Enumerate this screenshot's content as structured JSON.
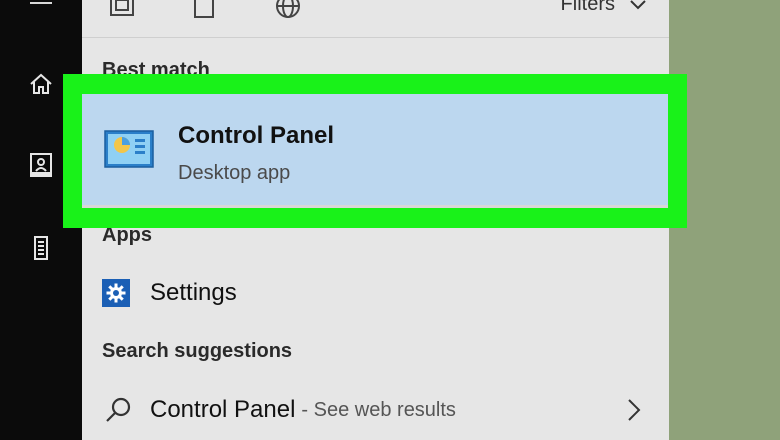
{
  "sidebar": {
    "icons": [
      "hamburger-icon",
      "home-icon",
      "notebook-icon",
      "tower-icon"
    ]
  },
  "topbar": {
    "icons": [
      "documents-icon",
      "blank-page-icon",
      "globe-icon"
    ],
    "filters_label": "Filters"
  },
  "best_match": {
    "heading": "Best match",
    "title": "Control Panel",
    "subtitle": "Desktop app",
    "icon": "control-panel-icon"
  },
  "apps": {
    "heading": "Apps",
    "items": [
      {
        "label": "Settings",
        "icon": "gear-icon"
      }
    ]
  },
  "suggestions": {
    "heading": "Search suggestions",
    "items": [
      {
        "label": "Control Panel",
        "suffix": "- See web results",
        "icon": "search-icon"
      }
    ]
  },
  "colors": {
    "highlight": "#19f219",
    "selection": "#bcd7ef",
    "accent": "#1b5fb5",
    "sidebar": "#0b0b0b",
    "panel": "#e6e6e6",
    "desktop": "#8fa27a"
  }
}
